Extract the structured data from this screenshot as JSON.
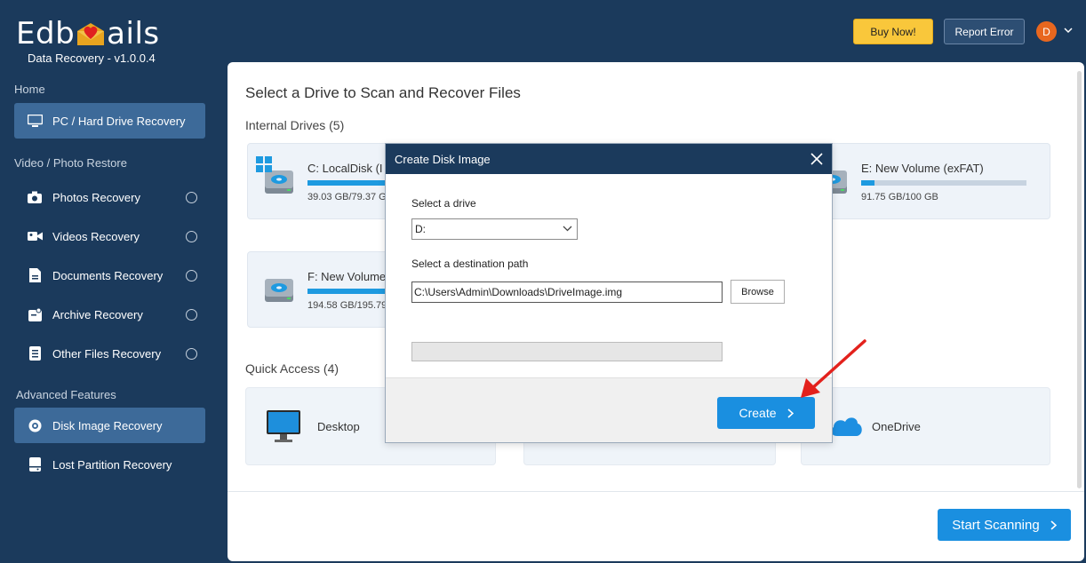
{
  "app": {
    "logo_left": "Edb",
    "logo_right": "ails",
    "version": "Data Recovery - v1.0.0.4"
  },
  "topbar": {
    "buy_label": "Buy Now!",
    "report_label": "Report Error",
    "avatar_initial": "D",
    "colors": {
      "buy": "#f9c73b",
      "report": "#2d4e73",
      "avatar": "#e8671f"
    }
  },
  "sidebar": {
    "home_heading": "Home",
    "video_heading": "Video / Photo Restore",
    "advanced_heading": "Advanced Features",
    "items": [
      {
        "label": "PC / Hard Drive Recovery",
        "icon": "monitor-icon",
        "active": true
      },
      {
        "label": "Photos Recovery",
        "icon": "camera-icon"
      },
      {
        "label": "Videos Recovery",
        "icon": "video-camera-icon"
      },
      {
        "label": "Documents Recovery",
        "icon": "document-icon"
      },
      {
        "label": "Archive Recovery",
        "icon": "archive-icon"
      },
      {
        "label": "Other Files Recovery",
        "icon": "file-list-icon"
      },
      {
        "label": "Disk Image Recovery",
        "icon": "disk-icon",
        "active": true
      },
      {
        "label": "Lost Partition Recovery",
        "icon": "drive-icon"
      }
    ]
  },
  "main": {
    "title": "Select a Drive to Scan and Recover Files",
    "internal_drives_label": "Internal Drives (5)",
    "drives": [
      {
        "name": "C: LocalDisk (I",
        "size": "39.03 GB/79.37 G",
        "used_fraction": 0.49,
        "system": true
      },
      {
        "name": "E: New Volume (exFAT)",
        "size": "91.75 GB/100 GB",
        "used_fraction": 0.08
      },
      {
        "name": "F: New Volume",
        "size": "194.58 GB/195.79",
        "used_fraction": 0.99
      }
    ],
    "quick_access_label": "Quick Access (4)",
    "quick_access": [
      {
        "label": "Desktop",
        "icon": "desktop-icon"
      },
      {
        "label": "OneDrive",
        "icon": "cloud-icon"
      }
    ],
    "scan_label": "Start Scanning"
  },
  "modal": {
    "title": "Create Disk Image",
    "drive_label": "Select a drive",
    "drive_value": "D:",
    "path_label": "Select a destination path",
    "path_value": "C:\\Users\\Admin\\Downloads\\DriveImage.img",
    "browse_label": "Browse",
    "progress": 0,
    "create_label": "Create"
  }
}
